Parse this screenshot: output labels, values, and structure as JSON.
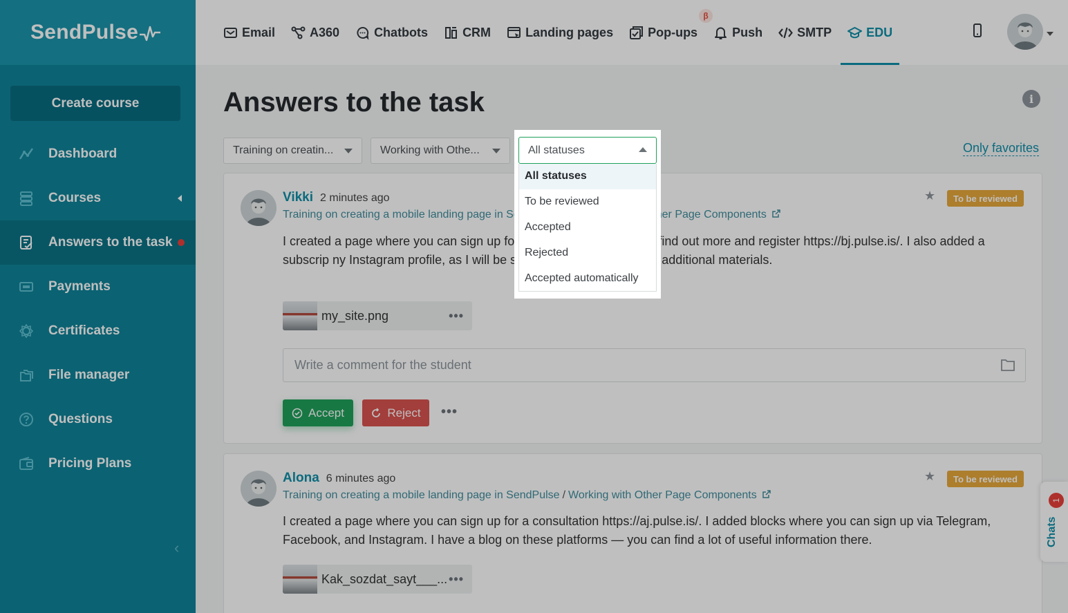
{
  "brand": {
    "name": "SendPulse"
  },
  "sidebar": {
    "create_button": "Create course",
    "items": [
      {
        "label": "Dashboard",
        "icon": "dashboard-icon"
      },
      {
        "label": "Courses",
        "icon": "courses-icon"
      },
      {
        "label": "Answers to the task",
        "icon": "answers-icon"
      },
      {
        "label": "Payments",
        "icon": "payments-icon"
      },
      {
        "label": "Certificates",
        "icon": "certificates-icon"
      },
      {
        "label": "File manager",
        "icon": "file-manager-icon"
      },
      {
        "label": "Questions",
        "icon": "questions-icon"
      },
      {
        "label": "Pricing Plans",
        "icon": "pricing-plans-icon"
      }
    ],
    "collapse": "‹"
  },
  "topnav": {
    "items": [
      {
        "label": "Email"
      },
      {
        "label": "A360"
      },
      {
        "label": "Chatbots"
      },
      {
        "label": "CRM"
      },
      {
        "label": "Landing pages"
      },
      {
        "label": "Pop-ups",
        "badge": "β"
      },
      {
        "label": "Push"
      },
      {
        "label": "SMTP"
      },
      {
        "label": "EDU"
      }
    ],
    "active": "EDU"
  },
  "page": {
    "title": "Answers to the task",
    "filters": {
      "course": "Training on creatin...",
      "lesson": "Working with Othe...",
      "status": "All statuses"
    },
    "only_favorites": "Only favorites",
    "status_options": [
      "All statuses",
      "To be reviewed",
      "Accepted",
      "Rejected",
      "Accepted automatically"
    ],
    "status_selected": "All statuses"
  },
  "answers": [
    {
      "name": "Vikki",
      "time": "2 minutes ago",
      "course": "Training on creating a mobile landing page in Se",
      "lesson": "ner Page Components",
      "text": "I created a page where you can sign up fo                                                          course. Follow the link to find out more and register https://bj.pulse.is/. I also added a subscrip                                                         ny Instagram profile, as I will be sending and posting lots of additional materials.",
      "status": "To be reviewed",
      "file": "my_site.png",
      "comment_placeholder": "Write a comment for the student",
      "accept": "Accept",
      "reject": "Reject"
    },
    {
      "name": "Alona",
      "time": "6 minutes ago",
      "course": "Training on creating a mobile landing page in SendPulse",
      "lesson": "Working with Other Page Components",
      "text": "I created a page where you can sign up for a consultation https://aj.pulse.is/. I added blocks where you can sign up via Telegram, Facebook, and Instagram. I have a blog on these platforms — you can find a lot of useful information there.",
      "status": "To be reviewed",
      "file": "Kak_sozdat_sayt___..."
    }
  ],
  "chats": {
    "label": "Chats",
    "count": "1"
  },
  "ui": {
    "more": "•••",
    "separator": "/"
  },
  "colors": {
    "accent": "#0f8fa8",
    "sidebar": "#0f8399",
    "accept": "#1fa05a",
    "reject": "#d9534f",
    "badge": "#e7a93b"
  }
}
